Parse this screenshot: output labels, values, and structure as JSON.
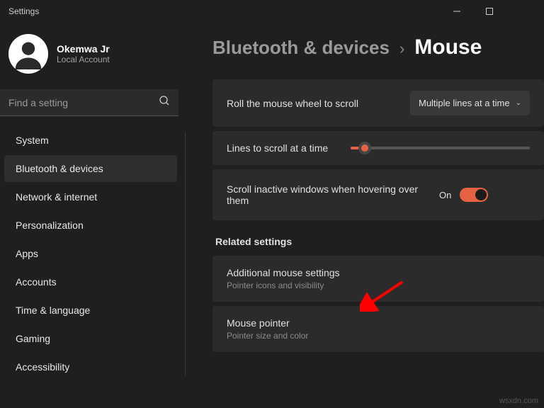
{
  "titlebar": {
    "title": "Settings"
  },
  "user": {
    "name": "Okemwa Jr",
    "sub": "Local Account"
  },
  "search": {
    "placeholder": "Find a setting"
  },
  "nav": {
    "items": [
      "System",
      "Bluetooth & devices",
      "Network & internet",
      "Personalization",
      "Apps",
      "Accounts",
      "Time & language",
      "Gaming",
      "Accessibility"
    ],
    "active_index": 1
  },
  "breadcrumb": {
    "parent": "Bluetooth & devices",
    "current": "Mouse"
  },
  "settings": {
    "scroll_wheel": {
      "label": "Roll the mouse wheel to scroll",
      "value": "Multiple lines at a time"
    },
    "lines": {
      "label": "Lines to scroll at a time"
    },
    "inactive": {
      "label": "Scroll inactive windows when hovering over them",
      "state_label": "On",
      "on": true
    }
  },
  "related": {
    "title": "Related settings",
    "items": [
      {
        "title": "Additional mouse settings",
        "sub": "Pointer icons and visibility"
      },
      {
        "title": "Mouse pointer",
        "sub": "Pointer size and color"
      }
    ]
  },
  "watermark": "wsxdn.com"
}
